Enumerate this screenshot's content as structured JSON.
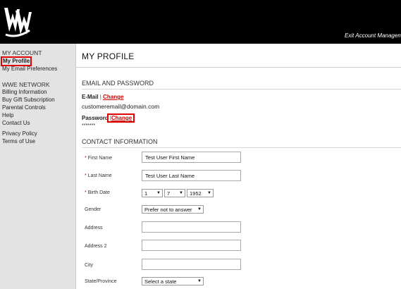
{
  "header": {
    "exit_label": "Exit Account Managem"
  },
  "sidebar": {
    "my_account_heading": "MY ACCOUNT",
    "my_profile": "My Profile",
    "my_email_prefs": "My Email Preferences",
    "network_heading": "WWE NETWORK",
    "billing": "Billing Information",
    "gift": "Buy Gift Subscription",
    "parental": "Parental Controls",
    "help": "Help",
    "contact": "Contact Us",
    "privacy": "Privacy Policy",
    "terms": "Terms of Use"
  },
  "main": {
    "title": "MY PROFILE",
    "email_section": "EMAIL AND PASSWORD",
    "email_label": "E-Mail",
    "pipe": "|",
    "change": "Change",
    "email_value": "customeremail@domain.com",
    "password_label": "Password",
    "password_value": "*******",
    "contact_section": "CONTACT INFORMATION",
    "req": "*",
    "first_name_label": "First Name",
    "first_name_value": "Test User First Name",
    "last_name_label": "Last Name",
    "last_name_value": "Test User Last Name",
    "birth_date_label": "Birth Date",
    "birth_month": "1",
    "birth_day": "7",
    "birth_year": "1952",
    "gender_label": "Gender",
    "gender_value": "Prefer not to answer",
    "address_label": "Address",
    "address2_label": "Address 2",
    "city_label": "City",
    "state_label": "State/Province",
    "state_value": "Select a state"
  }
}
